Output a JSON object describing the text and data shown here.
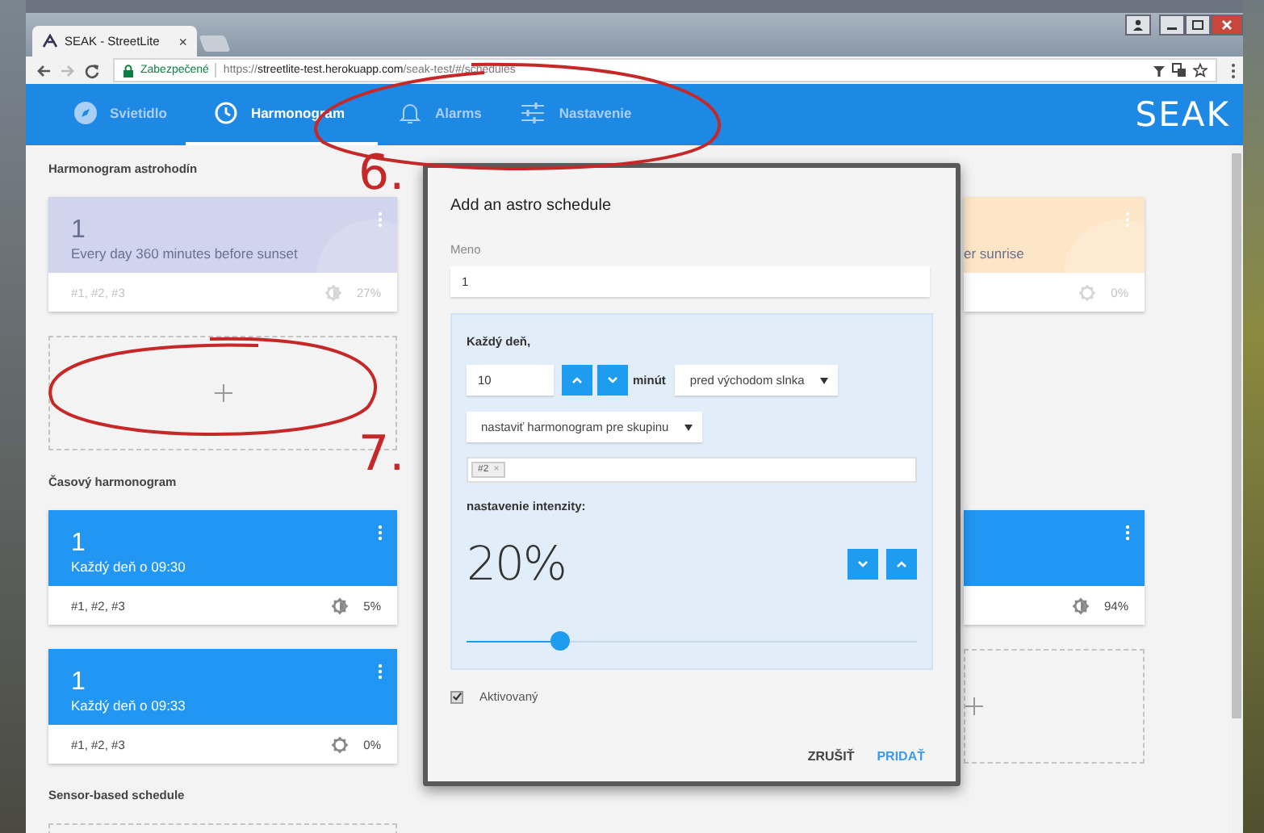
{
  "browser": {
    "tab_title": "SEAK - StreetLite",
    "tab_close": "×",
    "security_label": "Zabezpečené",
    "url_scheme": "https://",
    "url_host": "streetlite-test.herokuapp.com",
    "url_path": "/seak-test/#/schedules"
  },
  "nav": {
    "tabs": [
      {
        "label": "Svietidlo",
        "selected": false
      },
      {
        "label": "Harmonogram",
        "selected": true
      },
      {
        "label": "Alarms",
        "selected": false
      },
      {
        "label": "Nastavenie",
        "selected": false
      }
    ],
    "logo": "SEAK"
  },
  "sections": [
    {
      "title": "Harmonogram astrohodín",
      "rows": [
        {
          "left": {
            "kind": "schedule",
            "name": "1",
            "description": "Every day 360 minutes before sunset",
            "groups": "#1, #2, #3",
            "intensity": "27%",
            "lit": true,
            "faded": true,
            "color": "#d0d4ec"
          },
          "right": {
            "kind": "schedule",
            "description": "er sunrise",
            "intensity": "0%",
            "lit": false,
            "faded": true,
            "color": "#fde6c7"
          }
        },
        {
          "left": {
            "kind": "add"
          }
        }
      ]
    },
    {
      "title": "Časový harmonogram",
      "rows": [
        {
          "left": {
            "kind": "schedule",
            "name": "1",
            "description": "Každý deň o 09:30",
            "groups": "#1, #2, #3",
            "intensity": "5%",
            "lit": true,
            "faded": false,
            "color": "#2196f3"
          },
          "right": {
            "kind": "schedule",
            "intensity": "94%",
            "lit": true,
            "faded": false,
            "color": "#2196f3"
          }
        },
        {
          "left": {
            "kind": "schedule",
            "name": "1",
            "description": "Každý deň o 09:33",
            "groups": "#1, #2, #3",
            "intensity": "0%",
            "lit": false,
            "faded": false,
            "color": "#2196f3"
          },
          "right": {
            "kind": "add"
          }
        }
      ]
    },
    {
      "title": "Sensor-based schedule",
      "rows": [
        {
          "left": {
            "kind": "add_cut"
          }
        }
      ]
    }
  ],
  "dialog": {
    "title": "Add an astro schedule",
    "name_label": "Meno",
    "name_value": "1",
    "every_day_label": "Každý deň,",
    "minutes_value": "10",
    "minutes_label": "minút",
    "relation_select": "pred východom slnka",
    "target_select": "nastaviť harmonogram pre skupinu",
    "tags": [
      {
        "label": "#2",
        "remove": "×"
      }
    ],
    "intensity_label": "nastavenie intenzity:",
    "intensity_value": "20%",
    "slider": {
      "level": 0.2
    },
    "activated": {
      "label": "Aktivovaný",
      "checked": true
    },
    "buttons": [
      {
        "label": "ZRUŠIŤ",
        "kind": "secondary"
      },
      {
        "label": "PRIDAŤ",
        "kind": "primary"
      }
    ]
  },
  "annotations": [
    {
      "label": "6."
    },
    {
      "label": "7."
    }
  ]
}
